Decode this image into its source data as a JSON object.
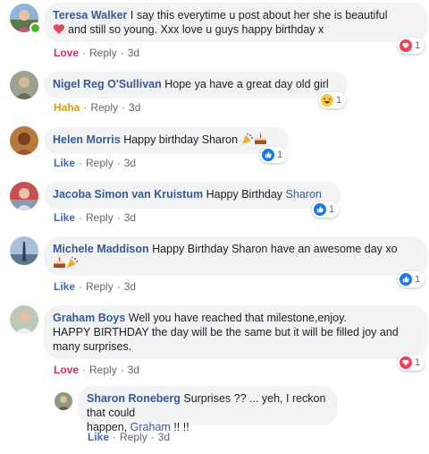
{
  "comments": [
    {
      "author": "Teresa Walker",
      "text": "I say this everytime u post about her she is beautiful",
      "text2": "and still so young. Xxx love u guys happy birthday x",
      "action": "Love",
      "reply": "Reply",
      "time": "3d",
      "reaction_count": "1",
      "reaction_icon": "heart-icon"
    },
    {
      "author": "Nigel Reg O'Sullivan",
      "text": "Hope ya have a great day old girl",
      "action": "Haha",
      "reply": "Reply",
      "time": "3d",
      "reaction_count": "1",
      "reaction_icon": "haha-icon"
    },
    {
      "author": "Helen Morris",
      "text": "Happy birthday Sharon",
      "action": "Like",
      "reply": "Reply",
      "time": "3d",
      "reaction_count": "1",
      "reaction_icon": "like-icon"
    },
    {
      "author": "Jacoba Simon van Kruistum",
      "text": "Happy Birthday",
      "mention": "Sharon",
      "action": "Like",
      "reply": "Reply",
      "time": "3d",
      "reaction_count": "1",
      "reaction_icon": "like-icon"
    },
    {
      "author": "Michele Maddison",
      "text": "Happy Birthday Sharon have an awesome day xo",
      "action": "Like",
      "reply": "Reply",
      "time": "3d",
      "reaction_count": "1",
      "reaction_icon": "like-icon"
    },
    {
      "author": "Graham Boys",
      "text": "Well you have reached that milestone,enjoy.",
      "text2": "HAPPY BIRTHDAY the day will be the same but it will be filled joy and",
      "text3": "many surprises.",
      "action": "Love",
      "reply": "Reply",
      "time": "3d",
      "reaction_count": "1",
      "reaction_icon": "heart-icon"
    }
  ],
  "reply": {
    "author": "Sharon Roneberg",
    "text": "Surprises ?? ... yeh, I reckon that could",
    "text2a": "happen,",
    "mention": "Graham",
    "text2b": "!! !!",
    "action": "Like",
    "reply": "Reply",
    "time": "3d"
  },
  "colors": {
    "author": "#385898",
    "like": "#4267b2",
    "love": "#e0245e",
    "haha": "#d7a000",
    "bubble": "#f2f3f5"
  }
}
